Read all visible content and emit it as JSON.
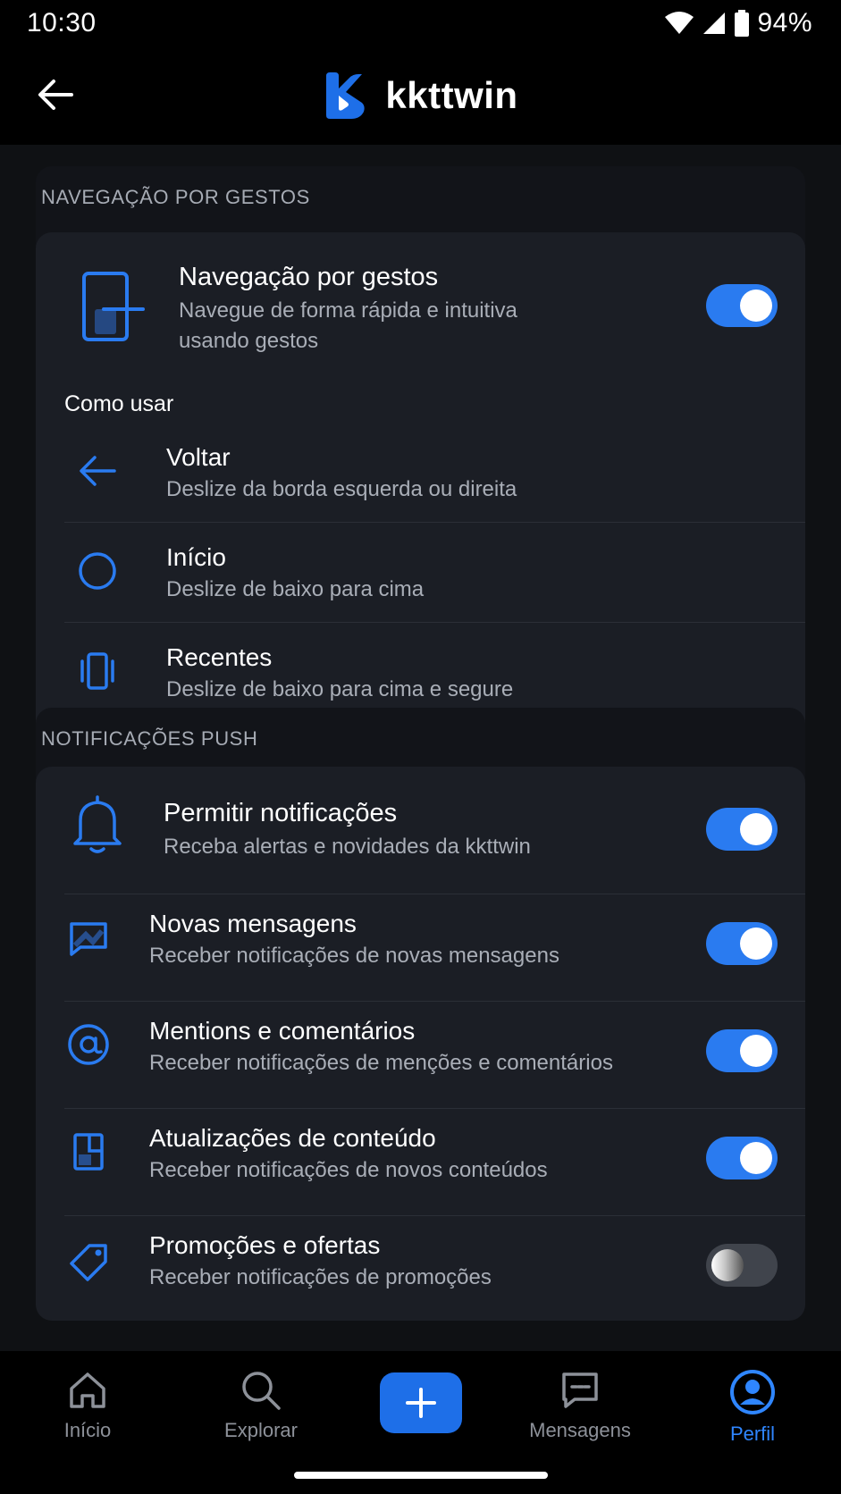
{
  "status": {
    "time": "10:30",
    "battery": "94%"
  },
  "header": {
    "app_name": "kkttwin"
  },
  "gestures": {
    "section_title": "NAVEGAÇÃO POR GESTOS",
    "main_title": "Navegação por gestos",
    "main_sub_line1": "Navegue de forma rápida e intuitiva",
    "main_sub_line2": "usando gestos",
    "main_enabled": true,
    "how_to_label": "Como usar",
    "items": [
      {
        "title": "Voltar",
        "sub": "Deslize da borda esquerda ou direita",
        "icon": "arrow-left-icon"
      },
      {
        "title": "Início",
        "sub": "Deslize de baixo para cima",
        "icon": "circle-icon"
      },
      {
        "title": "Recentes",
        "sub": "Deslize de baixo para cima e segure",
        "icon": "recents-icon"
      }
    ]
  },
  "push": {
    "section_title": "NOTIFICAÇÕES PUSH",
    "allow_title": "Permitir notificações",
    "allow_sub": "Receba alertas e novidades da kkttwin",
    "allow_enabled": true,
    "items": [
      {
        "title": "Novas mensagens",
        "sub": "Receber notificações de novas mensagens",
        "enabled": true,
        "icon": "message-icon"
      },
      {
        "title": "Mentions e comentários",
        "sub": "Receber notificações de menções e comentários",
        "enabled": true,
        "icon": "at-icon"
      },
      {
        "title": "Atualizações de conteúdo",
        "sub": "Receber notificações de novos conteúdos",
        "enabled": true,
        "icon": "content-icon"
      },
      {
        "title": "Promoções e ofertas",
        "sub": "Receber notificações de promoções",
        "enabled": false,
        "icon": "tag-icon"
      }
    ]
  },
  "nav": {
    "items": [
      {
        "label": "Início",
        "icon": "home-icon",
        "active": false
      },
      {
        "label": "Explorar",
        "icon": "search-icon",
        "active": false
      },
      {
        "label": "Mensagens",
        "icon": "chat-icon",
        "active": false
      },
      {
        "label": "Perfil",
        "icon": "profile-icon",
        "active": true
      }
    ],
    "fab_icon": "plus-icon"
  },
  "colors": {
    "accent": "#2a7bf0",
    "card": "#1b1e25",
    "background": "#0f1114"
  }
}
